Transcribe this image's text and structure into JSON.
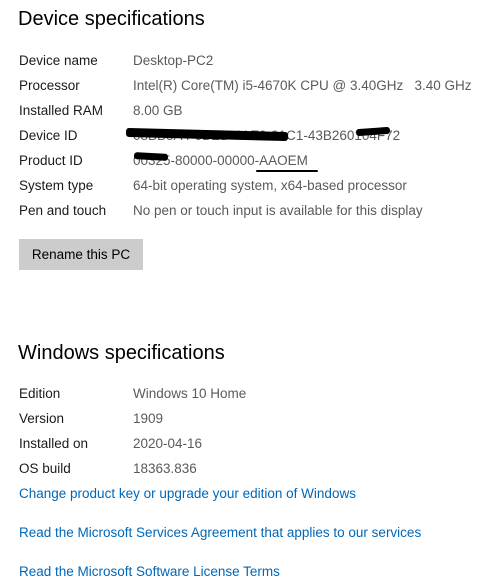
{
  "device_specs": {
    "title": "Device specifications",
    "rows": [
      {
        "label": "Device name",
        "value": "Desktop-PC2"
      },
      {
        "label": "Processor",
        "value": "Intel(R) Core(TM) i5-4670K CPU @ 3.40GHz   3.40 GHz"
      },
      {
        "label": "Installed RAM",
        "value": "8.00 GB"
      },
      {
        "label": "Device ID",
        "value": "08BB5A4-6BEB-4AE9-91C1-43B260104F72"
      },
      {
        "label": "Product ID",
        "value": "00325-80000-00000-AAOEM"
      },
      {
        "label": "System type",
        "value": "64-bit operating system, x64-based processor"
      },
      {
        "label": "Pen and touch",
        "value": "No pen or touch input is available for this display"
      }
    ],
    "rename_button": "Rename this PC"
  },
  "windows_specs": {
    "title": "Windows specifications",
    "rows": [
      {
        "label": "Edition",
        "value": "Windows 10 Home"
      },
      {
        "label": "Version",
        "value": "1909"
      },
      {
        "label": "Installed on",
        "value": "2020-04-16"
      },
      {
        "label": "OS build",
        "value": "18363.836"
      }
    ]
  },
  "links": {
    "change_product_key": "Change product key or upgrade your edition of Windows",
    "services_agreement": "Read the Microsoft Services Agreement that applies to our services",
    "license_terms": "Read the Microsoft Software License Terms"
  },
  "colors": {
    "link": "#0067b8",
    "value_text": "#5a5a5a",
    "button_bg": "#cccccc",
    "redaction": "#000000"
  }
}
